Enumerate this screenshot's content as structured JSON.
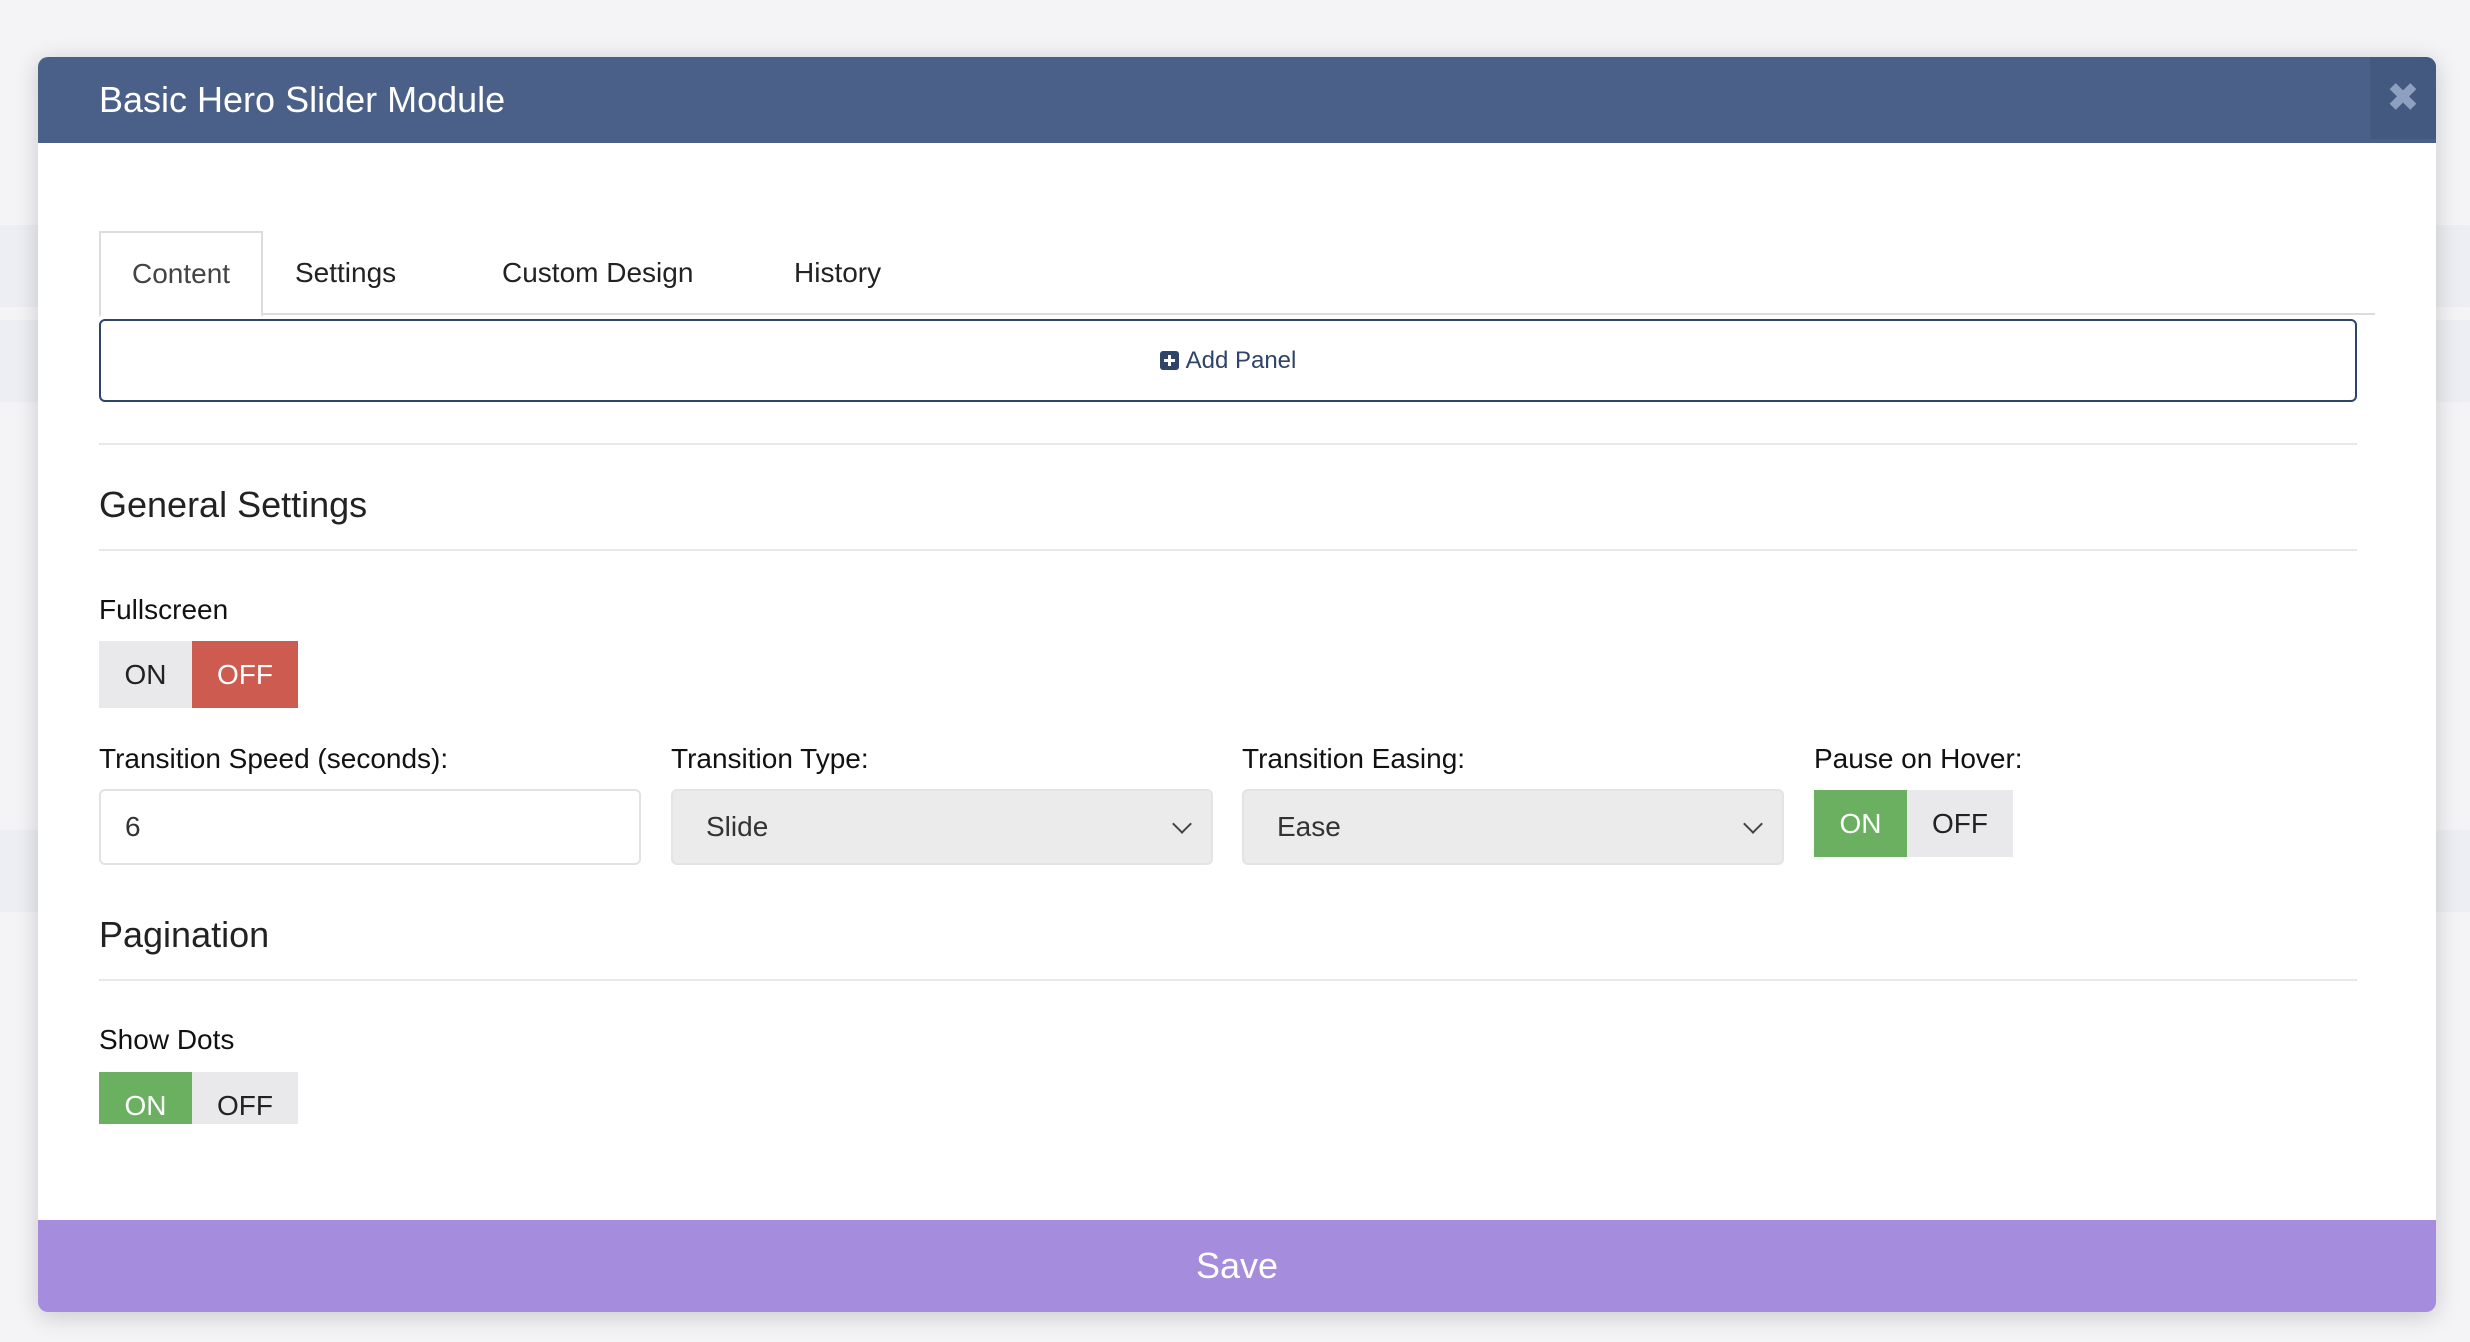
{
  "modal": {
    "title": "Basic Hero Slider Module",
    "close_icon": "close-icon"
  },
  "tabs": [
    {
      "label": "Content",
      "active": true
    },
    {
      "label": "Settings",
      "active": false
    },
    {
      "label": "Custom Design",
      "active": false
    },
    {
      "label": "History",
      "active": false
    }
  ],
  "add_panel": {
    "label": "Add Panel",
    "icon": "plus-square-icon"
  },
  "general": {
    "title": "General Settings",
    "fullscreen": {
      "label": "Fullscreen",
      "on": "ON",
      "off": "OFF",
      "value": "OFF"
    },
    "speed": {
      "label": "Transition Speed (seconds):",
      "value": "6"
    },
    "type": {
      "label": "Transition Type:",
      "value": "Slide"
    },
    "easing": {
      "label": "Transition Easing:",
      "value": "Ease"
    },
    "pause": {
      "label": "Pause on Hover:",
      "on": "ON",
      "off": "OFF",
      "value": "ON"
    }
  },
  "pagination": {
    "title": "Pagination",
    "dots": {
      "label": "Show Dots",
      "on": "ON",
      "off": "OFF",
      "value": "ON"
    }
  },
  "save": {
    "label": "Save"
  },
  "colors": {
    "header": "#4a6088",
    "off_active": "#cd5b4f",
    "on_active": "#6bb060",
    "save_bar": "#a58cdd"
  }
}
